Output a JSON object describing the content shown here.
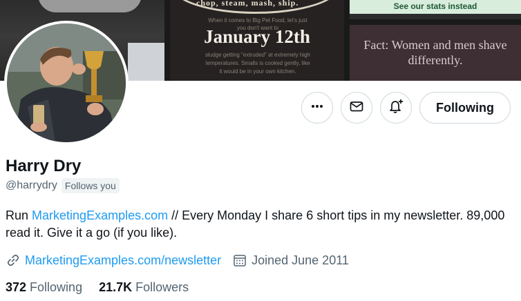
{
  "banner": {
    "arc_text": "chop, steam, mash, ship.",
    "small_top": "When it comes to Big Pet Food, let's just",
    "small_mid": "you don't want to",
    "big_text": "January 12th",
    "small_b1": "sludge getting \"extruded\" at extremely high",
    "small_b2": "temperatures. Smalls is cooked gently, like",
    "small_b3": "it would be in your own kitchen.",
    "strip_text": "See our stats instead",
    "fact_text": "Fact: Women and men shave differently."
  },
  "actions": {
    "more_icon": "more-horizontal-icon",
    "message_icon": "envelope-icon",
    "notify_icon": "bell-plus-icon",
    "follow_label": "Following"
  },
  "profile": {
    "name": "Harry Dry",
    "handle": "@harrydry",
    "follows_you": "Follows you",
    "bio_prefix": "Run ",
    "bio_link": "MarketingExamples.com",
    "bio_rest": " // Every Monday I share 6 short tips in my newsletter. 89,000 read it. Give it a go (if you like).",
    "website": "MarketingExamples.com/newsletter",
    "website_icon": "link-icon",
    "joined": "Joined June 2011",
    "joined_icon": "calendar-icon"
  },
  "stats": {
    "following_count": "372",
    "following_label": "Following",
    "followers_count": "21.7K",
    "followers_label": "Followers"
  },
  "colors": {
    "link": "#1d9bf0",
    "secondary_text": "#536471",
    "border": "#cfd9de"
  }
}
